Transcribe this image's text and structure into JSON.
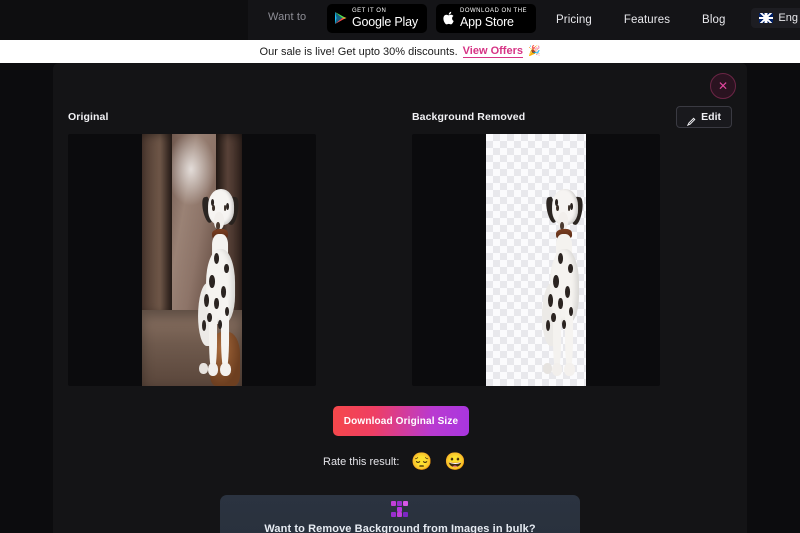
{
  "nav": {
    "want_to_text": "Want to",
    "store_badges": [
      {
        "name": "google-play",
        "small": "GET IT ON",
        "big": "Google Play",
        "icon": "google-play-icon"
      },
      {
        "name": "app-store",
        "small": "Download on the",
        "big": "App Store",
        "icon": "apple-icon"
      }
    ],
    "links": [
      {
        "label": "Pricing"
      },
      {
        "label": "Features"
      },
      {
        "label": "Blog"
      }
    ],
    "language": {
      "label": "Eng",
      "flag": "uk-flag-icon"
    }
  },
  "banner": {
    "text": "Our sale is live! Get upto 30% discounts.",
    "link_label": "View Offers",
    "emoji": "🎉"
  },
  "modal": {
    "close_label": "✕",
    "panels": [
      {
        "title": "Original",
        "image_alt": "dalmatian-dog-in-forest"
      },
      {
        "title": "Background Removed",
        "image_alt": "dalmatian-dog-transparent"
      }
    ],
    "edit_button": {
      "label": "Edit",
      "icon": "pencil-icon"
    },
    "download_button": {
      "label": "Download Original Size"
    },
    "rate": {
      "label": "Rate this result:",
      "options": [
        {
          "name": "sad-emoji",
          "glyph": "😔"
        },
        {
          "name": "happy-emoji",
          "glyph": "😀"
        }
      ]
    },
    "bulk_card": {
      "title": "Want to Remove Background from Images in bulk?",
      "logo": "pixel-x-logo"
    }
  },
  "colors": {
    "accent_pink": "#d63384",
    "close_pink": "#e0479e",
    "gradient_start": "#f5484a",
    "gradient_end": "#a936e0",
    "modal_bg": "#141416",
    "page_bg": "#0c0c0e",
    "bulk_card_bg": "#2b3340"
  }
}
